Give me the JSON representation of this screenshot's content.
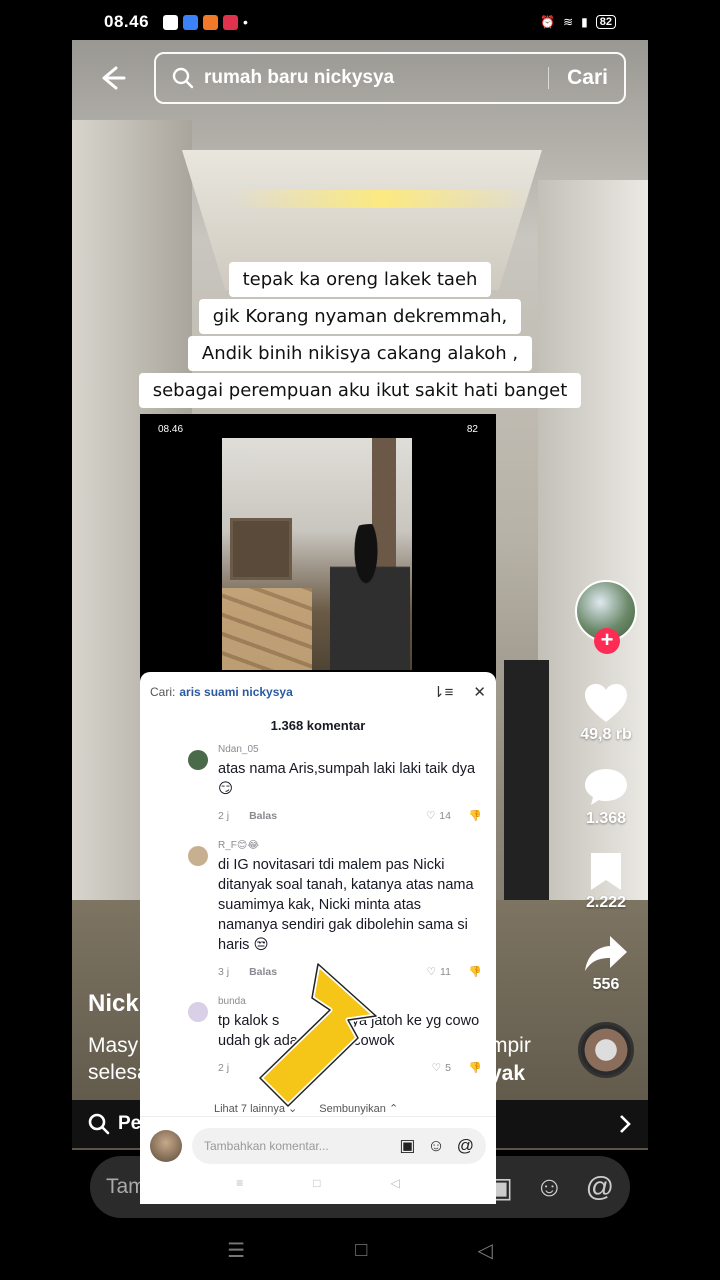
{
  "status_bar": {
    "time": "08.46",
    "battery": "82"
  },
  "search": {
    "query": "rumah baru nickysya",
    "button": "Cari"
  },
  "caption": [
    "tepak ka oreng lakek taeh",
    "gik Korang nyaman dekremmah,",
    "Andik binih nikisya cakang alakoh ,",
    "sebagai perempuan aku ikut sakit hati banget"
  ],
  "actions": {
    "likes": "49,8 rb",
    "comments": "1.368",
    "saves": "2.222",
    "shares": "556"
  },
  "video_info": {
    "author": "Nick",
    "desc_line1": "Masy",
    "desc_line2": "selesa",
    "desc_tail1": "mpir",
    "desc_tail2": "yak"
  },
  "related": {
    "label": "Pe"
  },
  "comment_bar": {
    "placeholder": "Tam"
  },
  "embed": {
    "status_time": "08.46",
    "battery": "82",
    "search_label": "Cari:",
    "search_term": "aris suami nickysya",
    "count": "1.368 komentar",
    "comments": [
      {
        "user": "Ndan_05",
        "text": "atas nama Aris,sumpah laki laki taik dya😏",
        "time": "2 j",
        "reply": "Balas",
        "likes": "14"
      },
      {
        "user": "R_F😊😂",
        "text": "di IG novitasari tdi malem pas Nicki ditanyak soal tanah, katanya atas nama suamimya kak, Nicki minta atas namanya sendiri gak dibolehin sama si haris 😒",
        "time": "3 j",
        "reply": "Balas",
        "likes": "11"
      },
      {
        "user": "bunda",
        "text": "tp kalok s            ahnya jatoh ke yg cowo           udah gk ada malu tu cowok",
        "time": "2 j",
        "reply": "",
        "likes": "5"
      }
    ],
    "more_replies": "Lihat 7 lainnya",
    "hide": "Sembunyikan",
    "input_placeholder": "Tambahkan komentar..."
  },
  "colors": {
    "accent": "#fe2c55",
    "arrow": "#f5c518"
  }
}
